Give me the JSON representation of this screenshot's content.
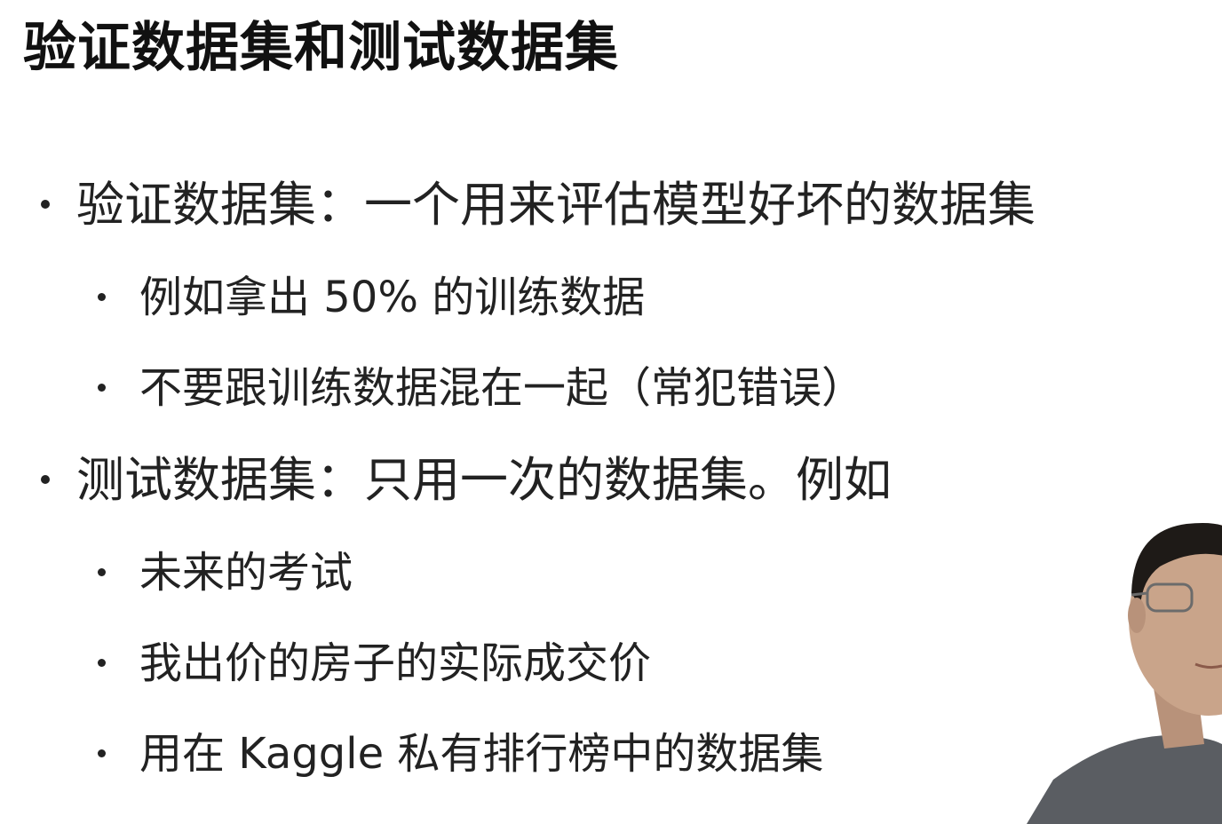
{
  "slide": {
    "title": "验证数据集和测试数据集"
  },
  "bullets": [
    {
      "level": 1,
      "text": "验证数据集：一个用来评估模型好坏的数据集"
    },
    {
      "level": 2,
      "text": "例如拿出 50% 的训练数据"
    },
    {
      "level": 2,
      "text": "不要跟训练数据混在一起（常犯错误）"
    },
    {
      "level": 1,
      "text": "测试数据集：只用一次的数据集。例如"
    },
    {
      "level": 2,
      "text": "未来的考试"
    },
    {
      "level": 2,
      "text": "我出价的房子的实际成交价"
    },
    {
      "level": 2,
      "text": "用在 Kaggle 私有排行榜中的数据集"
    }
  ],
  "colors": {
    "text": "#222222",
    "background": "#ffffff",
    "presenter_shirt": "#5a5d62",
    "presenter_skin": "#c9a48a"
  }
}
